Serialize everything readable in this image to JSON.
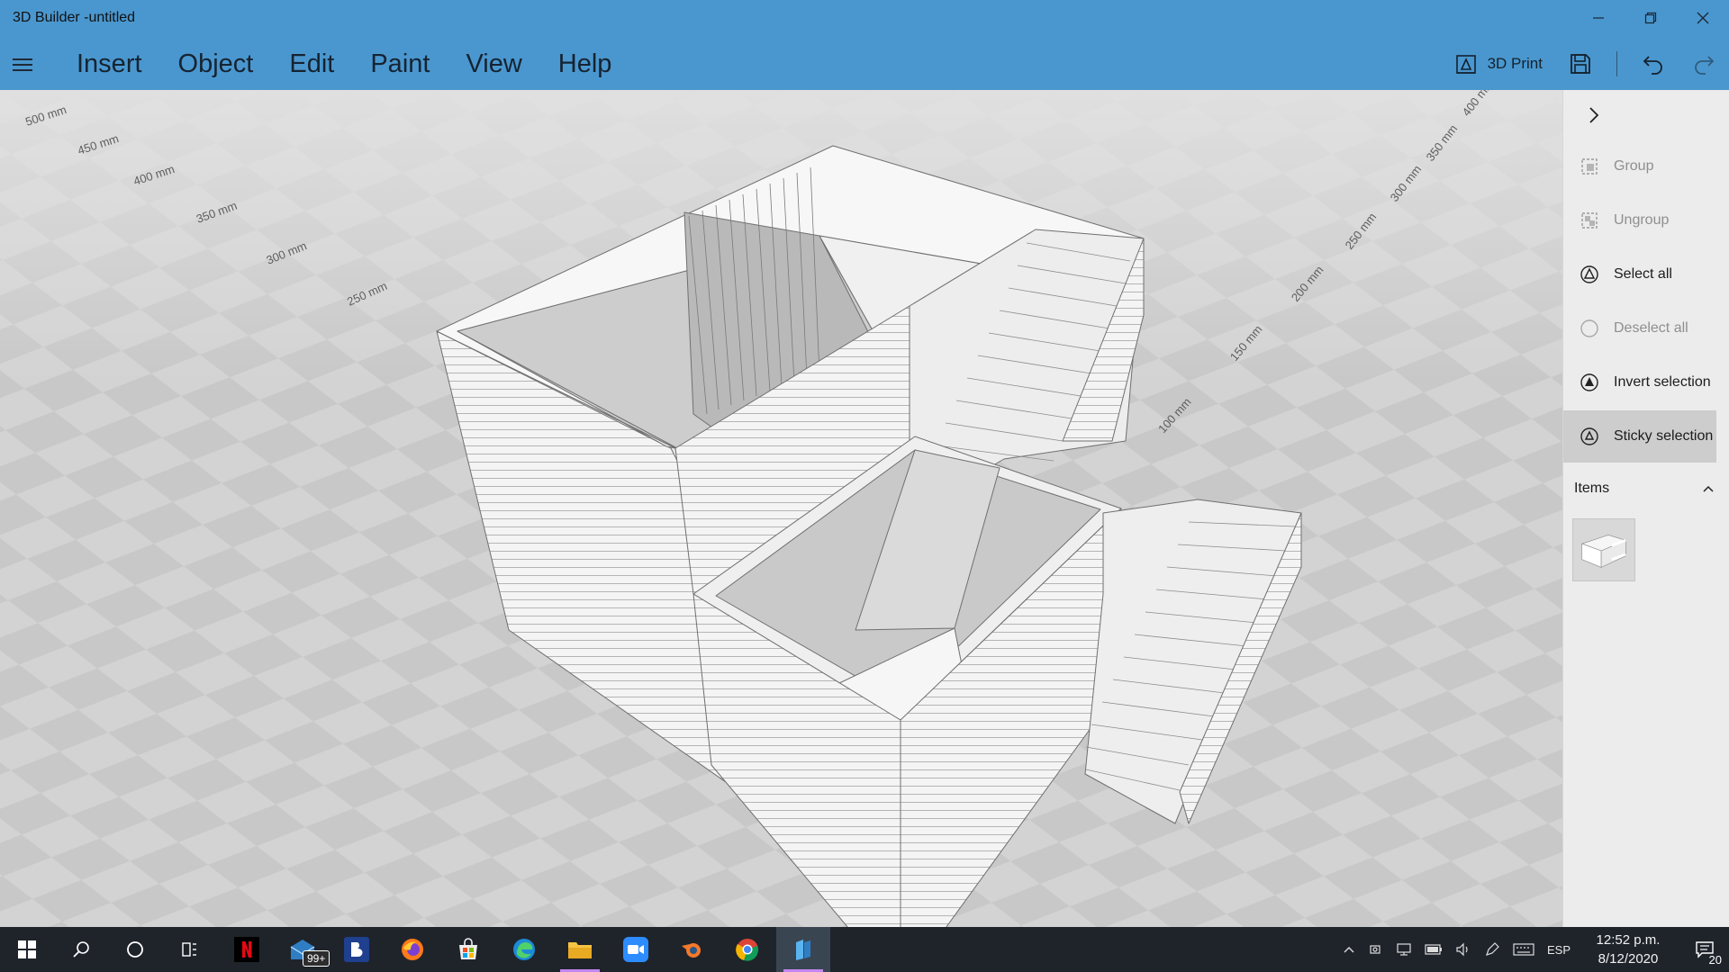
{
  "window": {
    "title": "3D Builder -untitled"
  },
  "menu": {
    "items": [
      "Insert",
      "Object",
      "Edit",
      "Paint",
      "View",
      "Help"
    ]
  },
  "toolbar": {
    "print_label": "3D Print"
  },
  "viewport": {
    "ruler_left": [
      "500 mm",
      "450 mm",
      "400 mm",
      "350 mm",
      "300 mm",
      "250 mm"
    ],
    "ruler_right": [
      "400 mm",
      "350 mm",
      "300 mm",
      "250 mm",
      "200 mm",
      "150 mm",
      "100 mm"
    ]
  },
  "panel": {
    "items": [
      {
        "label": "Group",
        "icon": "group-icon",
        "state": "disabled"
      },
      {
        "label": "Ungroup",
        "icon": "ungroup-icon",
        "state": "disabled"
      },
      {
        "label": "Select all",
        "icon": "select-all-icon",
        "state": "enabled"
      },
      {
        "label": "Deselect all",
        "icon": "deselect-all-icon",
        "state": "disabled"
      },
      {
        "label": "Invert selection",
        "icon": "invert-selection-icon",
        "state": "enabled"
      },
      {
        "label": "Sticky selection",
        "icon": "sticky-selection-icon",
        "state": "active"
      }
    ],
    "items_header": "Items"
  },
  "taskbar": {
    "mail_badge": "99+",
    "language": "ESP",
    "time": "12:52 p.m.",
    "date": "8/12/2020",
    "notification_count": "20"
  },
  "colors": {
    "titlebar": "#4a97cf",
    "panel": "#ececec",
    "taskbar": "#1f242b",
    "floor": "#cfcfcf"
  }
}
